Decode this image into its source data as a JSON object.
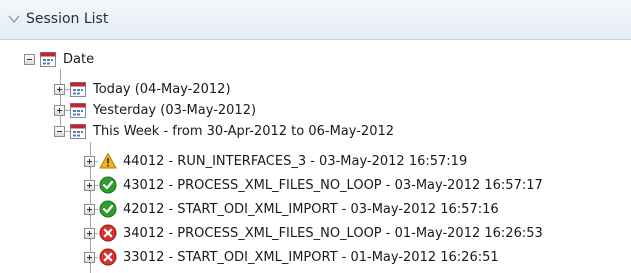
{
  "panel": {
    "title": "Session List"
  },
  "tree": {
    "root": {
      "label": "Date",
      "icon": "calendar-icon",
      "expanded": true
    },
    "groups": [
      {
        "label": "Today (04-May-2012)",
        "icon": "calendar-icon",
        "expanded": false
      },
      {
        "label": "Yesterday (03-May-2012)",
        "icon": "calendar-icon",
        "expanded": false
      },
      {
        "label": "This Week - from 30-Apr-2012 to 06-May-2012",
        "icon": "calendar-icon",
        "expanded": true
      }
    ],
    "sessions": [
      {
        "label": "44012 - RUN_INTERFACES_3 - 03-May-2012 16:57:19",
        "status": "warning",
        "icon": "warning-icon"
      },
      {
        "label": "43012 - PROCESS_XML_FILES_NO_LOOP - 03-May-2012 16:57:17",
        "status": "done",
        "icon": "success-check-icon"
      },
      {
        "label": "42012 - START_ODI_XML_IMPORT - 03-May-2012 16:57:16",
        "status": "done",
        "icon": "success-check-icon"
      },
      {
        "label": "34012 - PROCESS_XML_FILES_NO_LOOP - 01-May-2012 16:26:53",
        "status": "error",
        "icon": "error-x-icon"
      },
      {
        "label": "33012 - START_ODI_XML_IMPORT - 01-May-2012 16:26:51",
        "status": "error",
        "icon": "error-x-icon"
      }
    ]
  },
  "colors": {
    "success": "#2f9e2f",
    "error": "#d8322c",
    "warning": "#f2b21d",
    "calendar_header": "#c0262e"
  }
}
